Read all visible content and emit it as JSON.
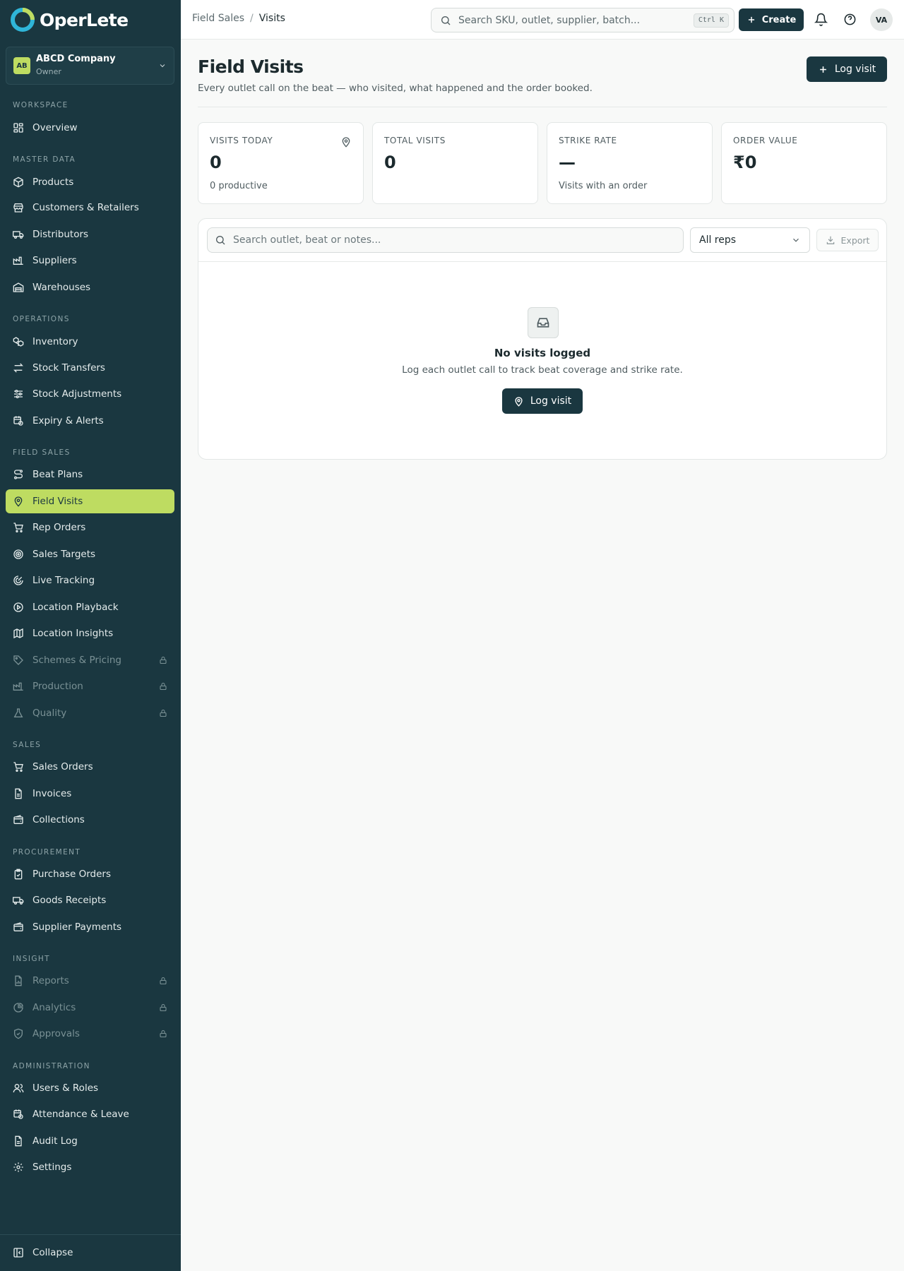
{
  "brand": {
    "name": "OperLete"
  },
  "company": {
    "badge": "AB",
    "name": "ABCD Company",
    "role": "Owner"
  },
  "sidebar": {
    "sections": {
      "workspace": "WORKSPACE",
      "master_data": "MASTER DATA",
      "operations": "OPERATIONS",
      "field_sales": "FIELD SALES",
      "sales": "SALES",
      "procurement": "PROCUREMENT",
      "insight": "INSIGHT",
      "administration": "ADMINISTRATION"
    },
    "items": {
      "overview": "Overview",
      "products": "Products",
      "customers": "Customers & Retailers",
      "distributors": "Distributors",
      "suppliers": "Suppliers",
      "warehouses": "Warehouses",
      "inventory": "Inventory",
      "stock_transfers": "Stock Transfers",
      "stock_adjustments": "Stock Adjustments",
      "expiry_alerts": "Expiry & Alerts",
      "beat_plans": "Beat Plans",
      "field_visits": "Field Visits",
      "rep_orders": "Rep Orders",
      "sales_targets": "Sales Targets",
      "live_tracking": "Live Tracking",
      "location_playback": "Location Playback",
      "location_insights": "Location Insights",
      "schemes_pricing": "Schemes & Pricing",
      "production": "Production",
      "quality": "Quality",
      "sales_orders": "Sales Orders",
      "invoices": "Invoices",
      "collections": "Collections",
      "purchase_orders": "Purchase Orders",
      "goods_receipts": "Goods Receipts",
      "supplier_payments": "Supplier Payments",
      "reports": "Reports",
      "analytics": "Analytics",
      "approvals": "Approvals",
      "users_roles": "Users & Roles",
      "attendance_leave": "Attendance & Leave",
      "audit_log": "Audit Log",
      "settings": "Settings"
    },
    "active": "field_visits",
    "collapse": "Collapse"
  },
  "topbar": {
    "breadcrumb": [
      "Field Sales",
      "Visits"
    ],
    "search_placeholder": "Search SKU, outlet, supplier, batch...",
    "shortcut": "Ctrl K",
    "create_label": "Create",
    "avatar_initials": "VA"
  },
  "page": {
    "title": "Field Visits",
    "subtitle": "Every outlet call on the beat — who visited, what happened and the order booked.",
    "log_visit_label": "Log visit"
  },
  "stats": [
    {
      "label": "VISITS TODAY",
      "value": "0",
      "sub": "0 productive",
      "icon": "map-pin-icon"
    },
    {
      "label": "TOTAL VISITS",
      "value": "0",
      "sub": ""
    },
    {
      "label": "STRIKE RATE",
      "value": "—",
      "sub": "Visits with an order"
    },
    {
      "label": "ORDER VALUE",
      "value": "₹0",
      "sub": ""
    }
  ],
  "filters": {
    "search_placeholder": "Search outlet, beat or notes...",
    "rep_select": "All reps",
    "export_label": "Export"
  },
  "empty_state": {
    "title": "No visits logged",
    "description": "Log each outlet call to track beat coverage and strike rate.",
    "button_label": "Log visit"
  },
  "colors": {
    "sidebar_bg": "#1a3740",
    "accent": "#bedc61",
    "primary_button": "#1a3740"
  }
}
